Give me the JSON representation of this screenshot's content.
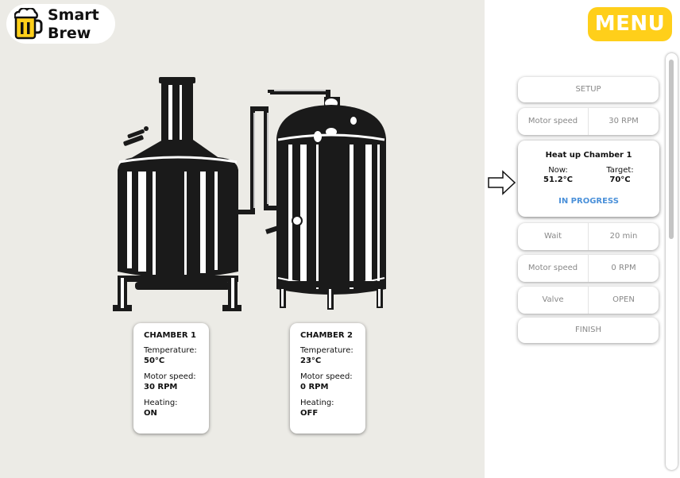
{
  "app": {
    "name_line1": "Smart",
    "name_line2": "Brew"
  },
  "menu": {
    "label": "MENU"
  },
  "chambers": [
    {
      "title": "CHAMBER 1",
      "temp_label": "Temperature:",
      "temp": "50°C",
      "speed_label": "Motor speed:",
      "speed": "30 RPM",
      "heat_label": "Heating:",
      "heat": "ON"
    },
    {
      "title": "CHAMBER 2",
      "temp_label": "Temperature:",
      "temp": "23°C",
      "speed_label": "Motor speed:",
      "speed": "0 RPM",
      "heat_label": "Heating:",
      "heat": "OFF"
    }
  ],
  "steps": {
    "setup": "SETUP",
    "motor1": {
      "label": "Motor speed",
      "value": "30 RPM"
    },
    "active": {
      "title": "Heat up Chamber 1",
      "now_label": "Now:",
      "now": "51.2°C",
      "target_label": "Target:",
      "target": "70°C",
      "status": "IN PROGRESS"
    },
    "wait": {
      "label": "Wait",
      "value": "20 min"
    },
    "motor2": {
      "label": "Motor speed",
      "value": "0 RPM"
    },
    "valve": {
      "label": "Valve",
      "value": "OPEN"
    },
    "finish": "FINISH"
  },
  "colors": {
    "accent": "#ffcf1a",
    "status": "#4a90d9",
    "panel_bg": "#ecebe6"
  },
  "icons": {
    "logo": "beer-mug-icon",
    "current_step": "arrow-right-icon"
  }
}
